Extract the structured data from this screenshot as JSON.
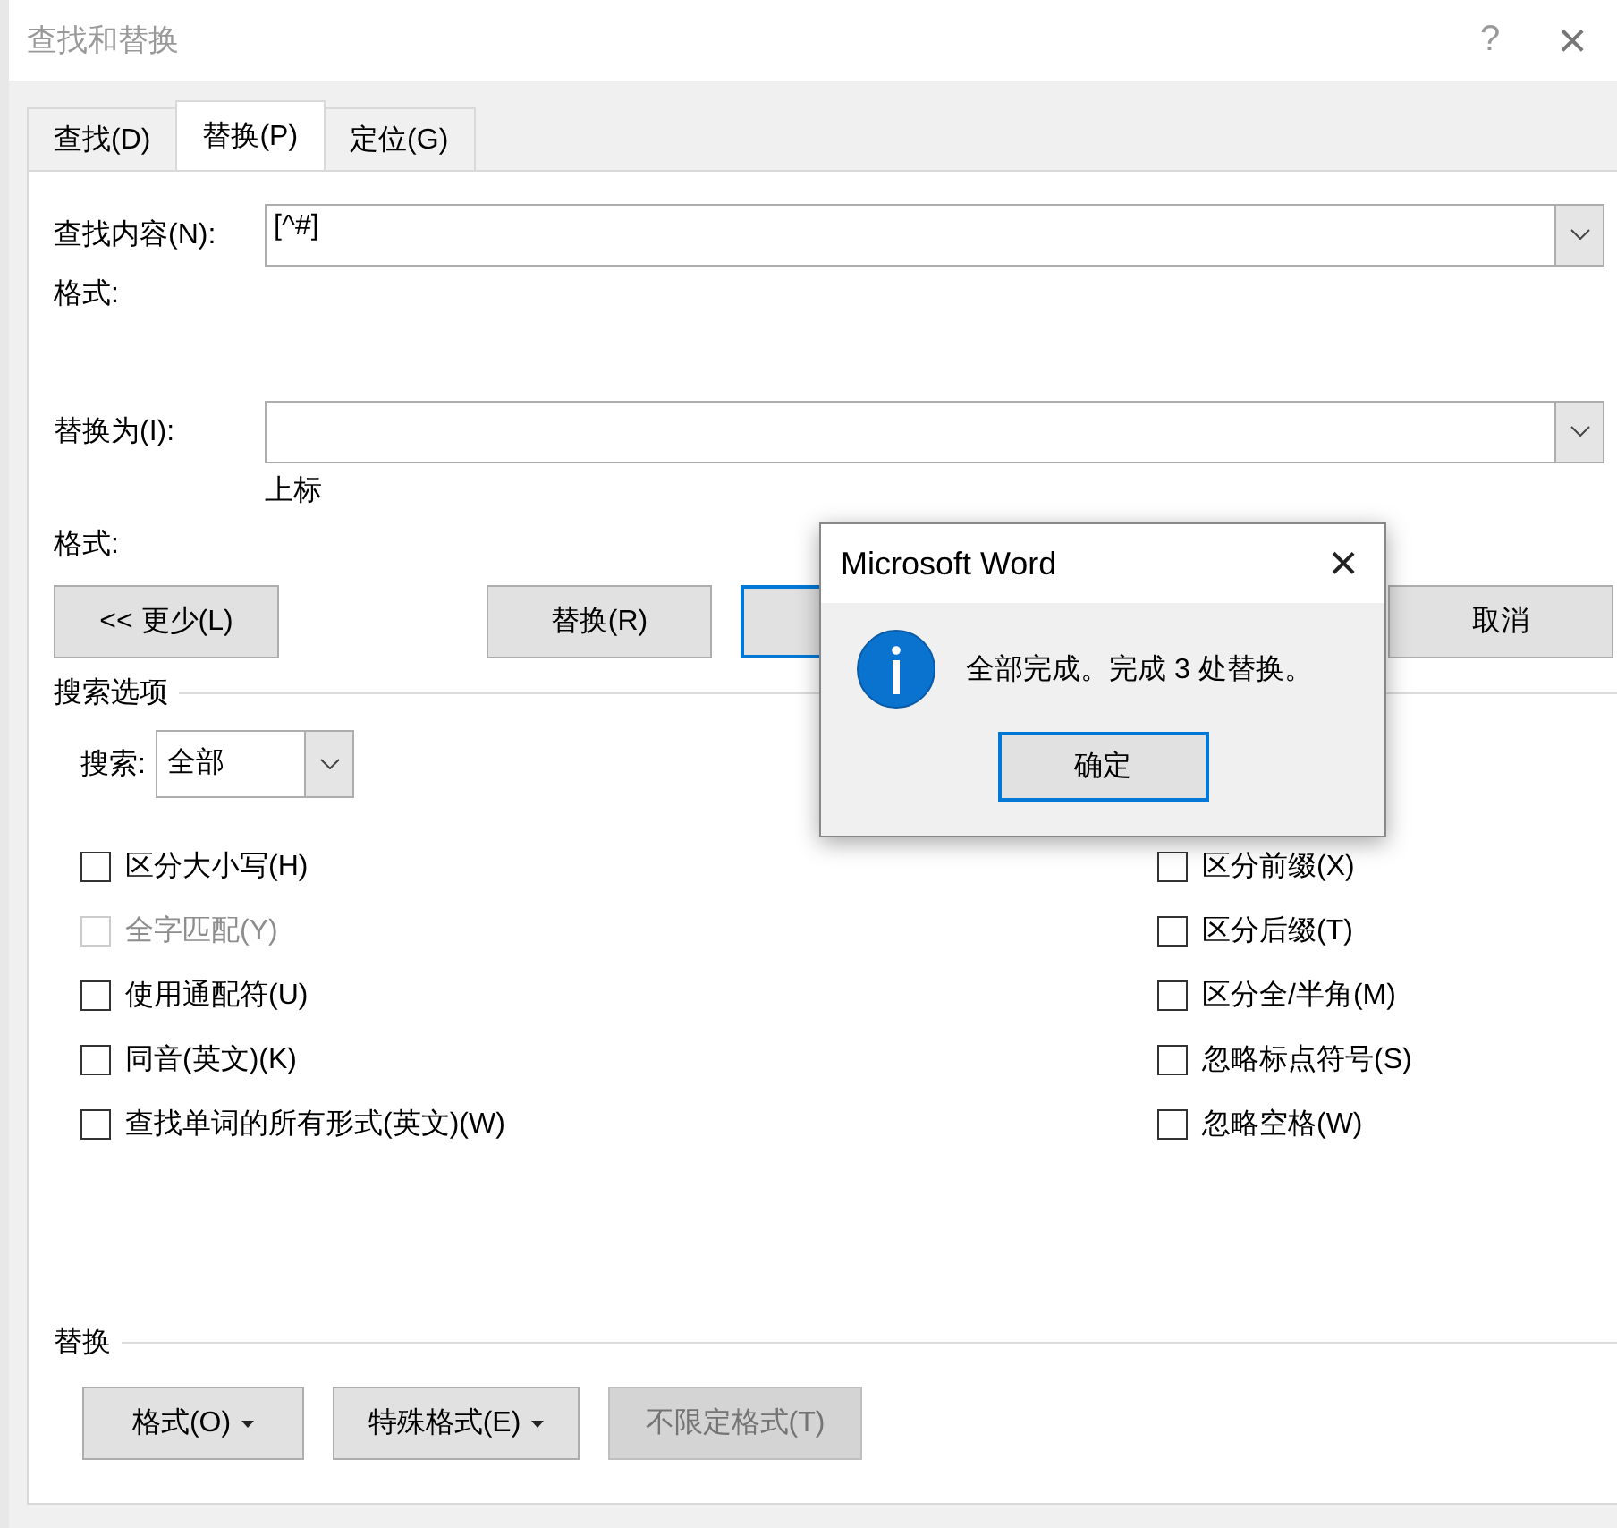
{
  "window": {
    "title": "查找和替换",
    "help": "?",
    "close": "×"
  },
  "tabs": [
    {
      "label": "查找(D)",
      "selected": false
    },
    {
      "label": "替换(P)",
      "selected": true
    },
    {
      "label": "定位(G)",
      "selected": false
    }
  ],
  "find": {
    "label": "查找内容(N):",
    "value": "[^#]",
    "format_label": "格式:"
  },
  "replace": {
    "label": "替换为(I):",
    "format_label": "格式:",
    "format": "上标"
  },
  "buttons": [
    {
      "label": "<< 更少(L)",
      "focused": false
    },
    {
      "label": "替换(R)",
      "focused": false
    },
    {
      "focused": true
    },
    {
      "label": "取消",
      "focused": false
    }
  ],
  "search_options": {
    "title": "搜索选项",
    "search_label": "搜索:",
    "search_value": "全部",
    "left": [
      {
        "label": "区分大小写(H)",
        "checked": false,
        "disabled": false
      },
      {
        "label": "全字匹配(Y)",
        "checked": false,
        "disabled": true
      },
      {
        "label": "使用通配符(U)",
        "checked": false,
        "disabled": false
      },
      {
        "label": "同音(英文)(K)",
        "checked": false,
        "disabled": false
      },
      {
        "label": "查找单词的所有形式(英文)(W)",
        "checked": false,
        "disabled": false
      }
    ],
    "right": [
      {
        "label": "区分前缀(X)",
        "checked": false,
        "disabled": false
      },
      {
        "label": "区分后缀(T)",
        "checked": false,
        "disabled": false
      },
      {
        "label": "区分全/半角(M)",
        "checked": false,
        "disabled": false
      },
      {
        "label": "忽略标点符号(S)",
        "checked": false,
        "disabled": false
      },
      {
        "label": "忽略空格(W)",
        "checked": false,
        "disabled": false
      }
    ]
  },
  "replace_section": {
    "title": "替换",
    "buttons": [
      {
        "label": "格式(O)",
        "dropdown": true,
        "disabled": false
      },
      {
        "label": "特殊格式(E)",
        "dropdown": true,
        "disabled": false
      },
      {
        "label": "不限定格式(T)",
        "dropdown": false,
        "disabled": true
      }
    ]
  },
  "message_box": {
    "title": "Microsoft Word",
    "close": "×",
    "message": "全部完成。完成 3 处替换。",
    "button": "确定"
  }
}
